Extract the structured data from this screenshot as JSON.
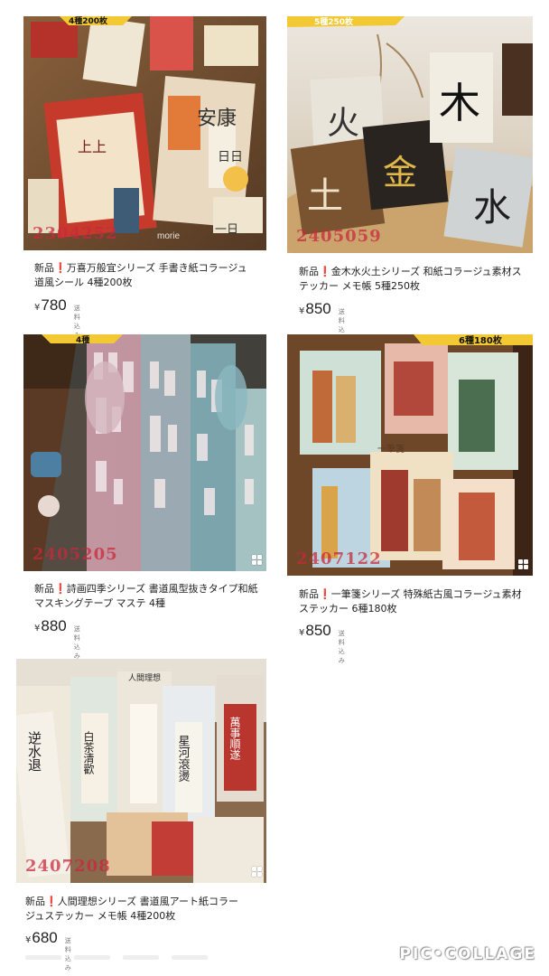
{
  "products": [
    {
      "image_code": "2304252",
      "image_watermark": "morie",
      "title_new": "新品",
      "title_excl": "❗",
      "title_line1": "万喜万般宜シリーズ 手書き紙コラージュ",
      "title_line2": "道風シール 4種200枚",
      "price_symbol": "¥",
      "price": "780",
      "shipping": "送料込み",
      "has_multi_images": false
    },
    {
      "image_code": "2405059",
      "image_watermark": "",
      "title_new": "新品",
      "title_excl": "❗",
      "title_line1": "金木水火土シリーズ 和紙コラージュ素材ス",
      "title_line2": "テッカー メモ帳 5種250枚",
      "price_symbol": "¥",
      "price": "850",
      "shipping": "送料込み",
      "has_multi_images": false
    },
    {
      "image_code": "2405205",
      "image_watermark": "",
      "title_new": "新品",
      "title_excl": "❗",
      "title_line1": "詩画四季シリーズ 書道風型抜きタイプ和紙",
      "title_line2": "マスキングテープ マステ 4種",
      "price_symbol": "¥",
      "price": "880",
      "shipping": "送料込み",
      "has_multi_images": true
    },
    {
      "image_code": "2407122",
      "image_watermark": "",
      "title_new": "新品",
      "title_excl": "❗",
      "title_line1": "一筆箋シリーズ 特殊紙古風コラージュ素材",
      "title_line2": "ステッカー 6種180枚",
      "price_symbol": "¥",
      "price": "850",
      "shipping": "送料込み",
      "has_multi_images": true
    },
    {
      "image_code": "2407208",
      "image_watermark": "",
      "title_new": "新品",
      "title_excl": "❗",
      "title_line1": "人間理想シリーズ 書道風アート紙コラー",
      "title_line2": "ジュステッカー メモ帳 4種200枚",
      "price_symbol": "¥",
      "price": "680",
      "shipping": "送料込み",
      "has_multi_images": true
    }
  ],
  "banners": {
    "p1": "4種200枚",
    "p2": "5種250枚",
    "p3": "4種",
    "p4": "6種180枚"
  },
  "photo_text": {
    "p1": [
      "安康",
      "日日",
      "一日",
      "上上"
    ],
    "p2": [
      "木",
      "火",
      "金",
      "土",
      "水"
    ],
    "p4": [
      "一筆箋"
    ],
    "p5": [
      "人間理想",
      "白茶清歡",
      "星河滾燙",
      "萬事順遂",
      "逆水退"
    ]
  },
  "collage_watermark": "PIC•COLLAGE",
  "accent_red": "#e0252e"
}
